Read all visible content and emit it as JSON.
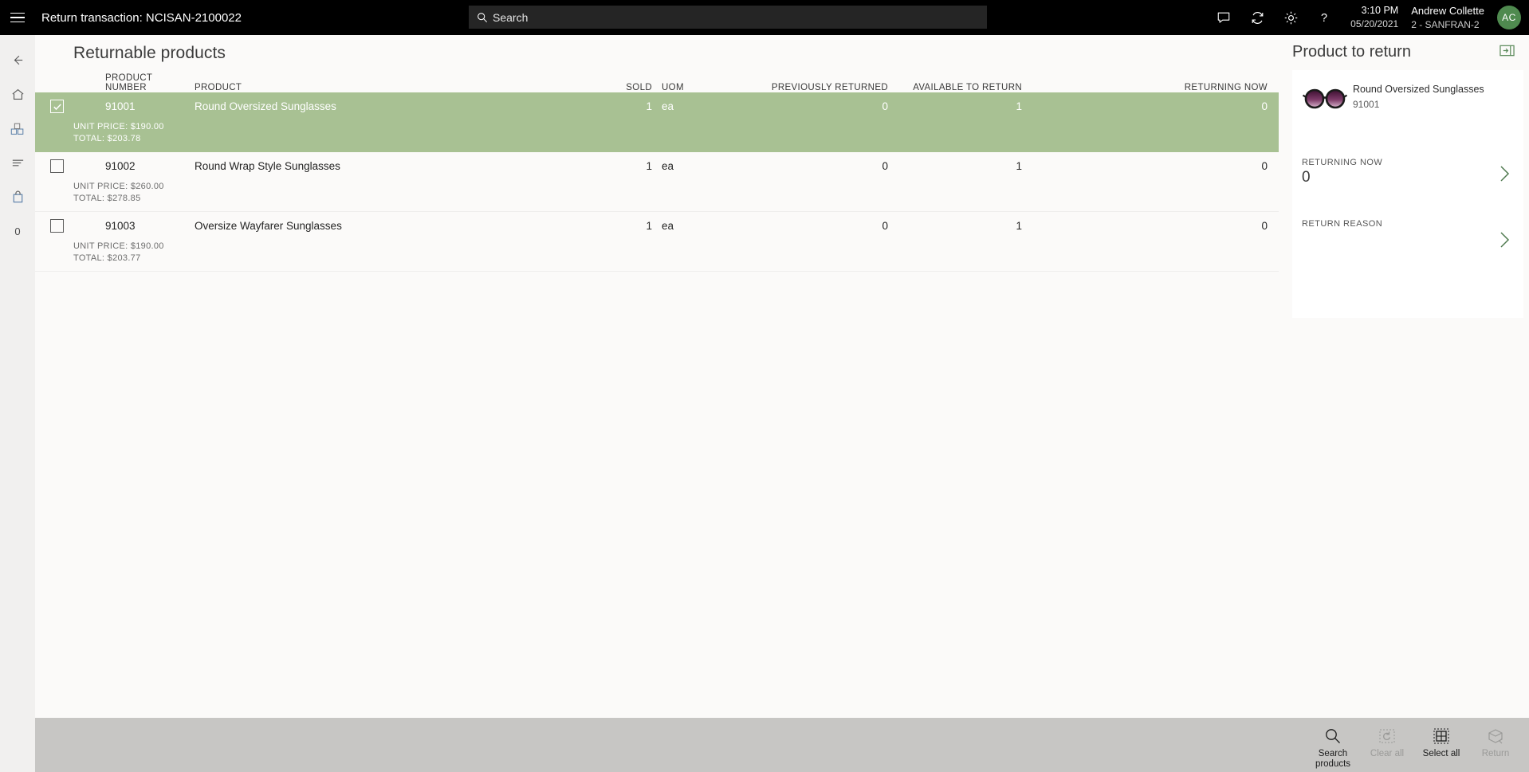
{
  "topbar": {
    "menu_icon": "hamburger-icon",
    "title": "Return transaction: NCISAN-2100022",
    "search_placeholder": "Search",
    "icons": [
      "message-icon",
      "sync-icon",
      "gear-icon",
      "help-icon"
    ],
    "time": "3:10 PM",
    "date": "05/20/2021",
    "user_name": "Andrew Collette",
    "user_store": "2 - SANFRAN-2",
    "avatar_initials": "AC"
  },
  "rail": {
    "items": [
      {
        "name": "back-icon",
        "label": "Back"
      },
      {
        "name": "home-icon",
        "label": "Home"
      },
      {
        "name": "products-icon",
        "label": "Products"
      },
      {
        "name": "list-icon",
        "label": "Journal"
      },
      {
        "name": "bag-icon",
        "label": "Cart"
      },
      {
        "name": "zero-count",
        "label": "0"
      }
    ]
  },
  "main": {
    "page_title": "Returnable products",
    "columns": [
      "PRODUCT NUMBER",
      "PRODUCT",
      "SOLD",
      "UOM",
      "PREVIOUSLY RETURNED",
      "AVAILABLE TO RETURN",
      "RETURNING NOW"
    ],
    "rows": [
      {
        "selected": true,
        "checked": true,
        "product_number": "91001",
        "product": "Round Oversized Sunglasses",
        "sold": "1",
        "uom": "ea",
        "previously_returned": "0",
        "available_to_return": "1",
        "returning_now": "0",
        "unit_price": "UNIT PRICE: $190.00",
        "total": "TOTAL: $203.78"
      },
      {
        "selected": false,
        "checked": false,
        "product_number": "91002",
        "product": "Round Wrap Style Sunglasses",
        "sold": "1",
        "uom": "ea",
        "previously_returned": "0",
        "available_to_return": "1",
        "returning_now": "0",
        "unit_price": "UNIT PRICE: $260.00",
        "total": "TOTAL: $278.85"
      },
      {
        "selected": false,
        "checked": false,
        "product_number": "91003",
        "product": "Oversize Wayfarer Sunglasses",
        "sold": "1",
        "uom": "ea",
        "previously_returned": "0",
        "available_to_return": "1",
        "returning_now": "0",
        "unit_price": "UNIT PRICE: $190.00",
        "total": "TOTAL: $203.77"
      }
    ]
  },
  "right_panel": {
    "title": "Product to return",
    "dock_icon": "dock-right-icon",
    "product_name": "Round Oversized Sunglasses",
    "product_number": "91001",
    "product_thumb": "sunglasses-thumbnail",
    "returning_now_label": "RETURNING NOW",
    "returning_now_value": "0",
    "return_reason_label": "RETURN REASON",
    "return_reason_value": ""
  },
  "appbar": {
    "buttons": [
      {
        "label": "Search\nproducts",
        "icon": "search-icon",
        "disabled": false
      },
      {
        "label": "Clear all",
        "icon": "clear-icon",
        "disabled": true
      },
      {
        "label": "Select all",
        "icon": "select-all-icon",
        "disabled": false
      },
      {
        "label": "Return",
        "icon": "return-box-icon",
        "disabled": true
      }
    ]
  },
  "colors": {
    "selection_green": "#a8c193",
    "topbar_black": "#000000",
    "appbar_gray": "#c7c6c4",
    "avatar_green": "#4f8a4f",
    "chevron_green": "#4f7a4f"
  }
}
